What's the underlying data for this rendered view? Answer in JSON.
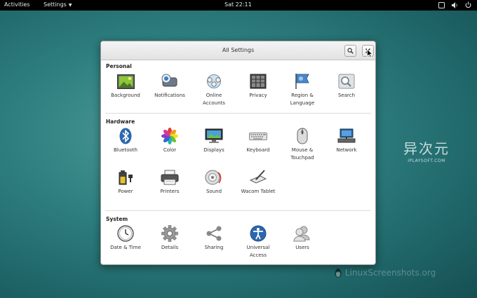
{
  "topbar": {
    "activities": "Activities",
    "app_menu": "Settings",
    "clock": "Sat 22:11"
  },
  "window": {
    "title": "All Settings",
    "search_icon": "search-icon",
    "close_icon": "close-icon"
  },
  "sections": {
    "personal": {
      "title": "Personal",
      "items": [
        {
          "label": "Background",
          "icon": "background-icon"
        },
        {
          "label": "Notifications",
          "icon": "notifications-icon"
        },
        {
          "label": "Online\nAccounts",
          "icon": "online-accounts-icon"
        },
        {
          "label": "Privacy",
          "icon": "privacy-icon"
        },
        {
          "label": "Region &\nLanguage",
          "icon": "region-flag-icon"
        },
        {
          "label": "Search",
          "icon": "search-settings-icon"
        }
      ]
    },
    "hardware": {
      "title": "Hardware",
      "items": [
        {
          "label": "Bluetooth",
          "icon": "bluetooth-icon"
        },
        {
          "label": "Color",
          "icon": "color-icon"
        },
        {
          "label": "Displays",
          "icon": "displays-icon"
        },
        {
          "label": "Keyboard",
          "icon": "keyboard-icon"
        },
        {
          "label": "Mouse &\nTouchpad",
          "icon": "mouse-icon"
        },
        {
          "label": "Network",
          "icon": "network-icon"
        },
        {
          "label": "Power",
          "icon": "power-icon"
        },
        {
          "label": "Printers",
          "icon": "printer-icon"
        },
        {
          "label": "Sound",
          "icon": "sound-icon"
        },
        {
          "label": "Wacom Tablet",
          "icon": "wacom-tablet-icon"
        }
      ]
    },
    "system": {
      "title": "System",
      "items": [
        {
          "label": "Date & Time",
          "icon": "clock-icon"
        },
        {
          "label": "Details",
          "icon": "gear-icon"
        },
        {
          "label": "Sharing",
          "icon": "sharing-icon"
        },
        {
          "label": "Universal\nAccess",
          "icon": "universal-access-icon"
        },
        {
          "label": "Users",
          "icon": "users-icon"
        }
      ]
    }
  },
  "watermarks": {
    "brand_cn": "异次元",
    "brand_url": "IPLAYSOFT.COM",
    "site": "LinuxScreenshots.org"
  }
}
